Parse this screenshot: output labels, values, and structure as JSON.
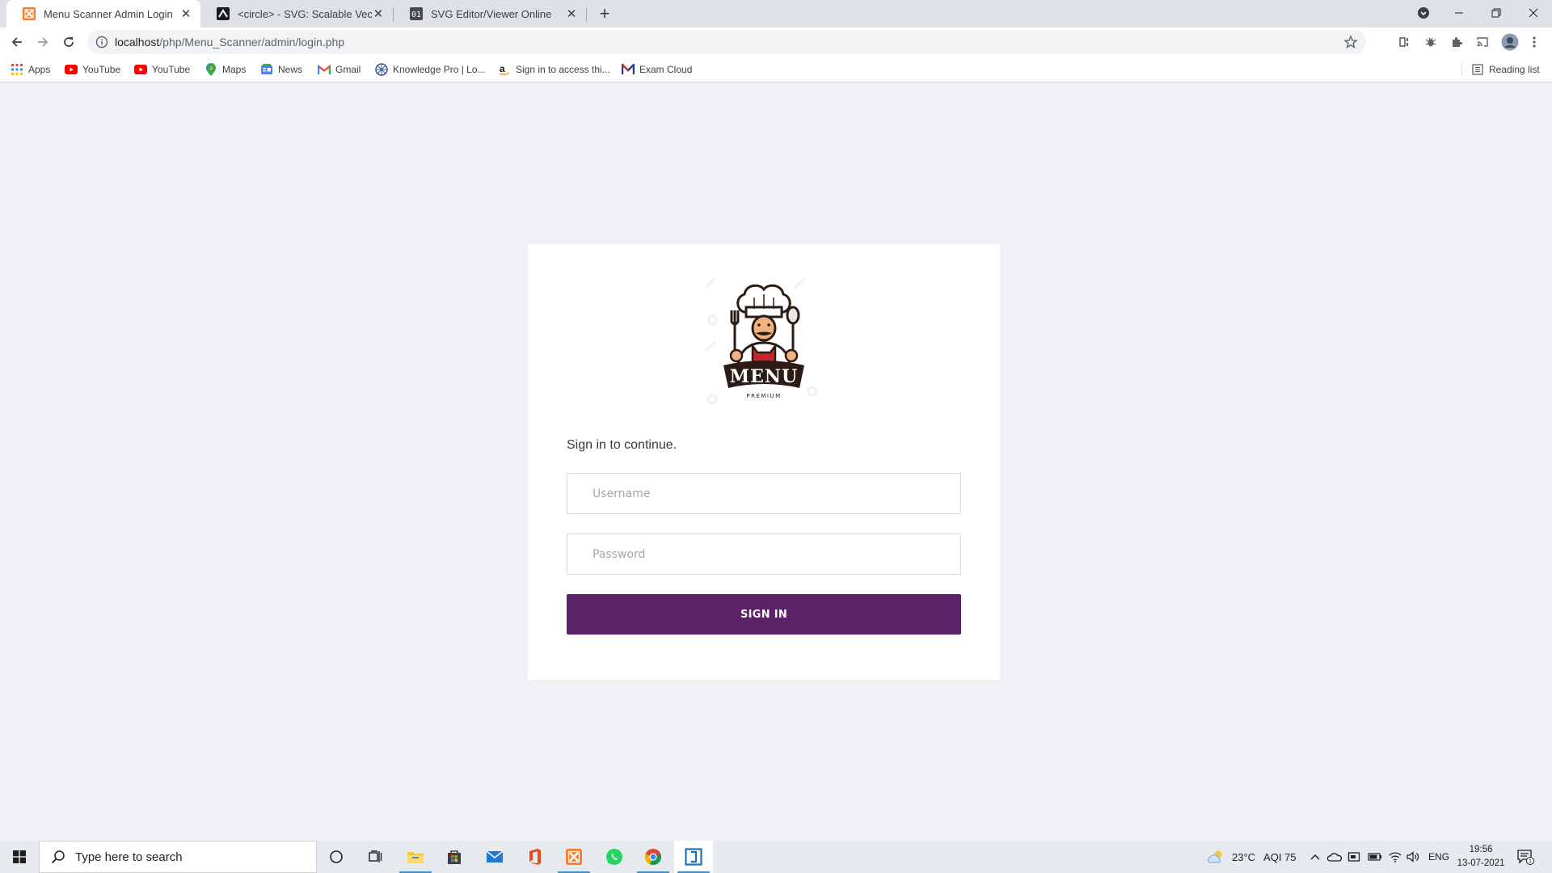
{
  "tabs": [
    {
      "title": "Menu Scanner Admin Login",
      "icon": "xampp-icon",
      "active": true
    },
    {
      "title": "<circle> - SVG: Scalable Vector G",
      "icon": "mdn-icon",
      "active": false
    },
    {
      "title": "SVG Editor/Viewer Online",
      "icon": "svg-editor-icon",
      "active": false
    }
  ],
  "address_bar": {
    "host": "localhost",
    "path": "/php/Menu_Scanner/admin/login.php"
  },
  "bookmarks": [
    {
      "label": "Apps",
      "icon": "apps-grid-icon"
    },
    {
      "label": "YouTube",
      "icon": "youtube-icon"
    },
    {
      "label": "YouTube",
      "icon": "youtube-icon"
    },
    {
      "label": "Maps",
      "icon": "maps-pin-icon"
    },
    {
      "label": "News",
      "icon": "news-icon"
    },
    {
      "label": "Gmail",
      "icon": "gmail-icon"
    },
    {
      "label": "Knowledge Pro | Lo...",
      "icon": "knowledge-pro-icon"
    },
    {
      "label": "Sign in to access thi...",
      "icon": "amazon-icon"
    },
    {
      "label": "Exam Cloud",
      "icon": "exam-cloud-icon"
    }
  ],
  "reading_list": "Reading list",
  "login": {
    "logo_text": "MENU",
    "logo_subtext": "PREMIUM",
    "subtitle": "Sign in to continue.",
    "username_placeholder": "Username",
    "password_placeholder": "Password",
    "signin_label": "SIGN IN"
  },
  "colors": {
    "page_bg": "#eff1f5",
    "primary_button": "#5b2268",
    "card_bg": "#ffffff"
  },
  "taskbar": {
    "search_placeholder": "Type here to search",
    "weather": "23°C",
    "aqi": "AQI 75",
    "language": "ENG",
    "time": "19:56",
    "date": "13-07-2021",
    "notification_count": "1"
  }
}
